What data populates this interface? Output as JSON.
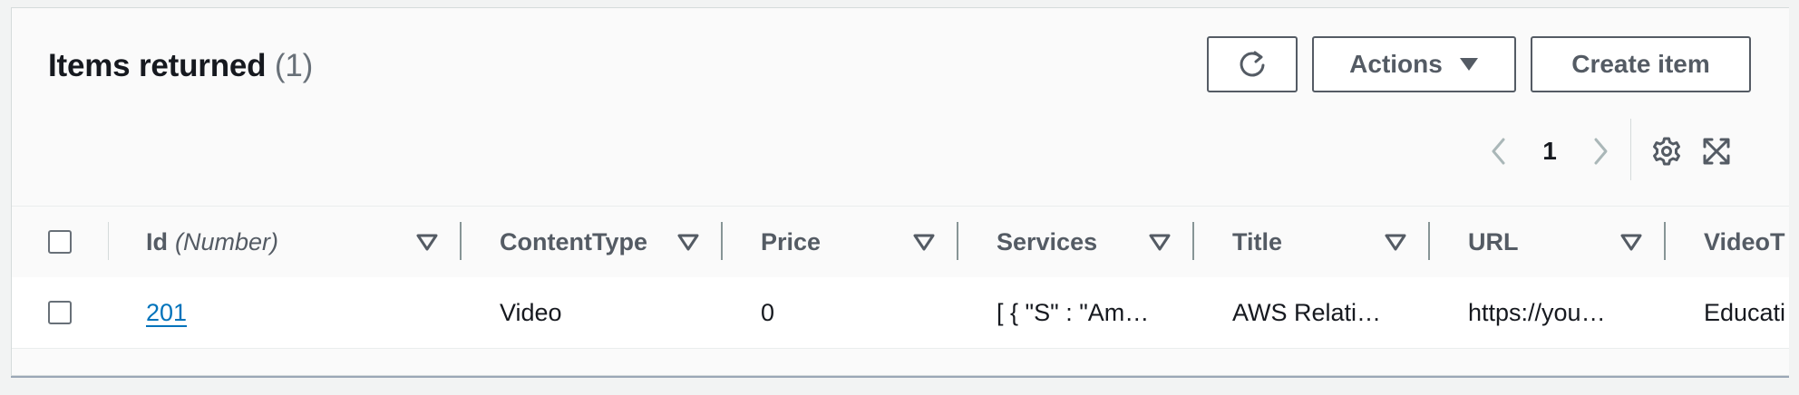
{
  "header": {
    "title": "Items returned",
    "count": "(1)"
  },
  "toolbar": {
    "refresh_icon": "refresh-icon",
    "actions_label": "Actions",
    "create_label": "Create item"
  },
  "pagination": {
    "current_page": "1",
    "prev_icon": "chevron-left-icon",
    "next_icon": "chevron-right-icon"
  },
  "tools": {
    "settings_icon": "gear-icon",
    "fullscreen_icon": "fullscreen-icon"
  },
  "table": {
    "columns": [
      {
        "label": "Id",
        "type": "(Number)"
      },
      {
        "label": "ContentType"
      },
      {
        "label": "Price"
      },
      {
        "label": "Services"
      },
      {
        "label": "Title"
      },
      {
        "label": "URL"
      },
      {
        "label": "VideoT"
      }
    ],
    "rows": [
      {
        "id": "201",
        "content_type": "Video",
        "price": "0",
        "services": "[ { \"S\" : \"Am…",
        "title": "AWS Relati…",
        "url": "https://you…",
        "video_type": "Educati"
      }
    ]
  },
  "colors": {
    "link": "#0073bb",
    "button_border": "#545b64",
    "header_text": "#545b64",
    "panel_bg": "#fafafa",
    "page_bg": "#f2f3f3"
  }
}
